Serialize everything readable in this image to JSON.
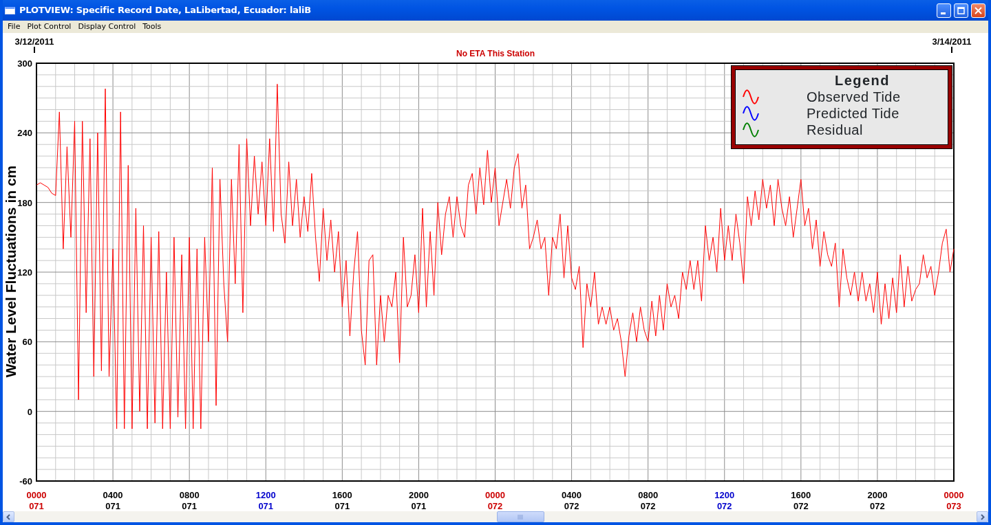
{
  "window": {
    "title": "PLOTVIEW: Specific Record Date, LaLibertad, Ecuador: laliB"
  },
  "menu": [
    "File",
    "Plot Control",
    "Display Control",
    "Tools"
  ],
  "plot": {
    "start_date": "3/12/2011",
    "end_date": "3/14/2011",
    "legend": {
      "title": "Legend",
      "other_items": [
        {
          "label": "Predicted Tide",
          "color": "#0000ff"
        },
        {
          "label": "Residual",
          "color": "#008000"
        }
      ]
    },
    "tick_labels": [
      {
        "day": "071",
        "color": "#cc0000"
      },
      {
        "day": "071",
        "color": "#000000"
      },
      {
        "day": "071",
        "color": "#000000"
      },
      {
        "day": "071",
        "color": "#0000cc"
      },
      {
        "day": "071",
        "color": "#000000"
      },
      {
        "day": "071",
        "color": "#000000"
      },
      {
        "day": "072",
        "color": "#cc0000"
      },
      {
        "day": "072",
        "color": "#000000"
      },
      {
        "day": "072",
        "color": "#000000"
      },
      {
        "day": "072",
        "color": "#0000cc"
      },
      {
        "day": "072",
        "color": "#000000"
      },
      {
        "day": "072",
        "color": "#000000"
      },
      {
        "day": "073",
        "color": "#cc0000"
      }
    ],
    "chart_data": {
      "type": "line",
      "title": "No ETA This Station",
      "ylabel": "Water Level Fluctuations in cm",
      "ylim": [
        -60,
        300
      ],
      "grid": true,
      "yticks": [
        300,
        240,
        180,
        120,
        60,
        0,
        -60
      ],
      "categories": [
        "0000",
        null,
        null,
        null,
        null,
        null,
        null,
        null,
        null,
        null,
        null,
        null,
        null,
        null,
        null,
        null,
        null,
        null,
        null,
        null,
        "0400",
        null,
        null,
        null,
        null,
        null,
        null,
        null,
        null,
        null,
        null,
        null,
        null,
        null,
        null,
        null,
        null,
        null,
        null,
        null,
        "0800",
        null,
        null,
        null,
        null,
        null,
        null,
        null,
        null,
        null,
        null,
        null,
        null,
        null,
        null,
        null,
        null,
        null,
        null,
        null,
        "1200",
        null,
        null,
        null,
        null,
        null,
        null,
        null,
        null,
        null,
        null,
        null,
        null,
        null,
        null,
        null,
        null,
        null,
        null,
        null,
        "1600",
        null,
        null,
        null,
        null,
        null,
        null,
        null,
        null,
        null,
        null,
        null,
        null,
        null,
        null,
        null,
        null,
        null,
        null,
        null,
        "2000",
        null,
        null,
        null,
        null,
        null,
        null,
        null,
        null,
        null,
        null,
        null,
        null,
        null,
        null,
        null,
        null,
        null,
        null,
        null,
        "0000",
        null,
        null,
        null,
        null,
        null,
        null,
        null,
        null,
        null,
        null,
        null,
        null,
        null,
        null,
        null,
        null,
        null,
        null,
        null,
        "0400",
        null,
        null,
        null,
        null,
        null,
        null,
        null,
        null,
        null,
        null,
        null,
        null,
        null,
        null,
        null,
        null,
        null,
        null,
        null,
        "0800",
        null,
        null,
        null,
        null,
        null,
        null,
        null,
        null,
        null,
        null,
        null,
        null,
        null,
        null,
        null,
        null,
        null,
        null,
        null,
        "1200",
        null,
        null,
        null,
        null,
        null,
        null,
        null,
        null,
        null,
        null,
        null,
        null,
        null,
        null,
        null,
        null,
        null,
        null,
        null,
        "1600",
        null,
        null,
        null,
        null,
        null,
        null,
        null,
        null,
        null,
        null,
        null,
        null,
        null,
        null,
        null,
        null,
        null,
        null,
        null,
        "2000",
        null,
        null,
        null,
        null,
        null,
        null,
        null,
        null,
        null,
        null,
        null,
        null,
        null,
        null,
        null,
        null,
        null,
        null,
        null,
        "0000"
      ],
      "series": [
        {
          "name": "Observed Tide",
          "color": "#ff0000",
          "values": [
            195,
            197,
            195,
            193,
            188,
            186,
            258,
            140,
            228,
            150,
            250,
            10,
            250,
            85,
            235,
            30,
            240,
            35,
            278,
            30,
            140,
            -15,
            258,
            -15,
            212,
            -15,
            175,
            0,
            160,
            -15,
            150,
            -10,
            155,
            -15,
            120,
            -15,
            150,
            -5,
            135,
            -15,
            150,
            -15,
            140,
            -15,
            150,
            60,
            210,
            5,
            200,
            110,
            60,
            200,
            110,
            230,
            85,
            235,
            160,
            220,
            170,
            215,
            160,
            235,
            155,
            282,
            170,
            145,
            215,
            160,
            200,
            150,
            185,
            155,
            205,
            150,
            112,
            175,
            130,
            165,
            120,
            155,
            90,
            130,
            65,
            120,
            155,
            70,
            40,
            130,
            135,
            40,
            100,
            60,
            100,
            90,
            120,
            42,
            150,
            90,
            100,
            135,
            85,
            175,
            90,
            155,
            100,
            180,
            135,
            170,
            185,
            150,
            185,
            160,
            150,
            195,
            205,
            170,
            210,
            178,
            225,
            180,
            210,
            160,
            180,
            200,
            175,
            210,
            222,
            175,
            195,
            140,
            150,
            165,
            140,
            150,
            100,
            150,
            140,
            170,
            115,
            160,
            115,
            105,
            125,
            55,
            110,
            90,
            120,
            75,
            90,
            75,
            90,
            70,
            80,
            60,
            30,
            65,
            85,
            60,
            90,
            70,
            60,
            95,
            65,
            100,
            70,
            110,
            90,
            100,
            80,
            120,
            105,
            130,
            105,
            130,
            95,
            160,
            130,
            150,
            120,
            175,
            130,
            160,
            130,
            170,
            145,
            110,
            185,
            160,
            190,
            165,
            200,
            175,
            195,
            160,
            200,
            175,
            160,
            185,
            150,
            175,
            200,
            160,
            175,
            140,
            165,
            125,
            155,
            135,
            125,
            145,
            90,
            140,
            115,
            100,
            120,
            95,
            120,
            95,
            110,
            85,
            120,
            75,
            110,
            80,
            115,
            85,
            135,
            90,
            125,
            95,
            105,
            110,
            135,
            115,
            125,
            100,
            120,
            145,
            157,
            120,
            140
          ]
        }
      ]
    }
  }
}
